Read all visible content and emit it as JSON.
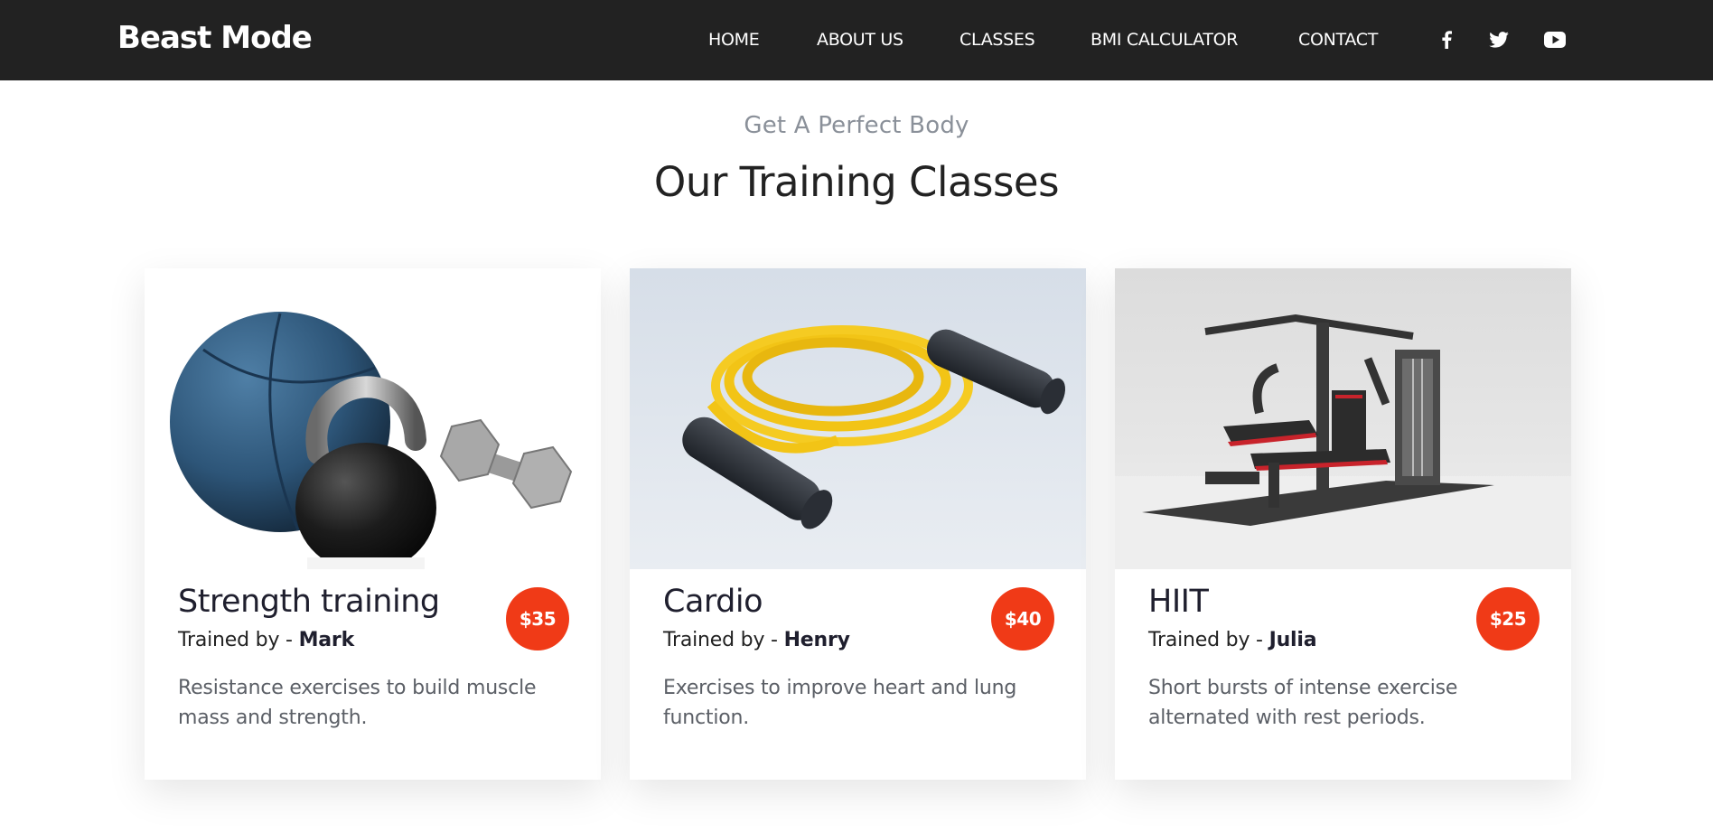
{
  "brand": "Beast Mode",
  "nav": {
    "items": [
      {
        "label": "HOME"
      },
      {
        "label": "ABOUT US"
      },
      {
        "label": "CLASSES"
      },
      {
        "label": "BMI CALCULATOR"
      },
      {
        "label": "CONTACT"
      }
    ],
    "social": [
      "facebook-icon",
      "twitter-icon",
      "youtube-icon"
    ]
  },
  "section": {
    "subtitle": "Get A Perfect Body",
    "title": "Our Training Classes"
  },
  "classes": [
    {
      "name": "Strength training",
      "trainer_prefix": "Trained by - ",
      "trainer": "Mark",
      "price": "$35",
      "description": "Resistance exercises to build muscle mass and strength.",
      "image": "kettlebell-ball-dumbbells"
    },
    {
      "name": "Cardio",
      "trainer_prefix": "Trained by - ",
      "trainer": "Henry",
      "price": "$40",
      "description": "Exercises to improve heart and lung function.",
      "image": "jump-rope"
    },
    {
      "name": "HIIT",
      "trainer_prefix": "Trained by - ",
      "trainer": "Julia",
      "price": "$25",
      "description": "Short bursts of intense exercise alternated with rest periods.",
      "image": "home-gym-machine"
    }
  ],
  "colors": {
    "navbar": "#222222",
    "accent": "#f03a17",
    "subtitle": "#8a9099"
  }
}
